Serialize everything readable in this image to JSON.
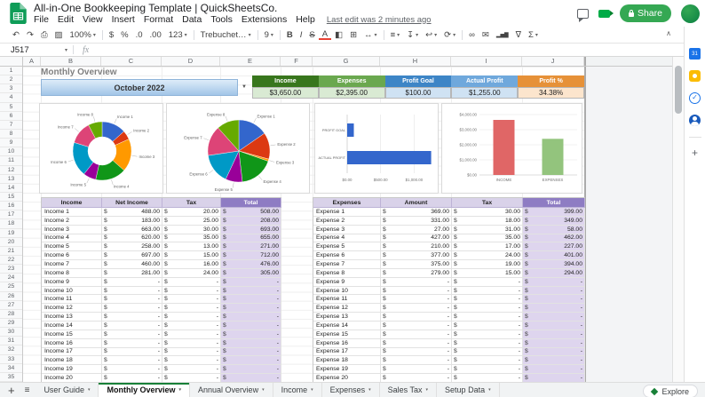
{
  "chrome": {
    "doc_title": "All-in-One Bookkeeping Template | QuickSheetsCo.",
    "menus": [
      "File",
      "Edit",
      "View",
      "Insert",
      "Format",
      "Data",
      "Tools",
      "Extensions",
      "Help"
    ],
    "last_edit": "Last edit was 2 minutes ago",
    "share_label": "Share",
    "formula": {
      "name_box": "J517",
      "fx": "fx"
    },
    "toolbar": {
      "items": [
        {
          "n": "undo-icon",
          "g": "↶"
        },
        {
          "n": "redo-icon",
          "g": "↷"
        },
        {
          "n": "print-icon",
          "g": "⎙"
        },
        {
          "n": "paint-format-icon",
          "g": "▨"
        },
        {
          "n": "zoom-select",
          "g": "100%",
          "dd": true
        },
        {
          "n": "divider"
        },
        {
          "n": "format-currency-icon",
          "g": "$"
        },
        {
          "n": "format-percent-icon",
          "g": "%"
        },
        {
          "n": "decrease-decimals-icon",
          "g": ".0"
        },
        {
          "n": "increase-decimals-icon",
          "g": ".00"
        },
        {
          "n": "number-format-select",
          "g": "123",
          "dd": true
        },
        {
          "n": "divider"
        },
        {
          "n": "font-select",
          "g": "Trebuchet…",
          "dd": true
        },
        {
          "n": "divider"
        },
        {
          "n": "font-size-select",
          "g": "9",
          "dd": true
        },
        {
          "n": "divider"
        },
        {
          "n": "bold-icon",
          "g": "B"
        },
        {
          "n": "italic-icon",
          "g": "I"
        },
        {
          "n": "strikethrough-icon",
          "g": "S"
        },
        {
          "n": "text-color-icon",
          "g": "A"
        },
        {
          "n": "fill-color-icon",
          "g": "◧"
        },
        {
          "n": "borders-icon",
          "g": "⊞"
        },
        {
          "n": "merge-cells-icon",
          "g": "↔",
          "dd": true
        },
        {
          "n": "divider"
        },
        {
          "n": "horizontal-align-icon",
          "g": "≡",
          "dd": true
        },
        {
          "n": "vertical-align-icon",
          "g": "↧",
          "dd": true
        },
        {
          "n": "text-wrap-icon",
          "g": "↩",
          "dd": true
        },
        {
          "n": "text-rotate-icon",
          "g": "⟳",
          "dd": true
        },
        {
          "n": "divider"
        },
        {
          "n": "insert-link-icon",
          "g": "∞"
        },
        {
          "n": "insert-comment-icon",
          "g": "✉"
        },
        {
          "n": "insert-chart-icon",
          "g": "▂▅▇"
        },
        {
          "n": "create-filter-icon",
          "g": "∇"
        },
        {
          "n": "functions-icon",
          "g": "Σ",
          "dd": true
        }
      ]
    }
  },
  "sheet": {
    "columns": [
      "A",
      "B",
      "C",
      "D",
      "E",
      "F",
      "G",
      "H",
      "I",
      "J"
    ],
    "row_count": 35,
    "title": "Monthly Overview",
    "month": "October 2022",
    "cards": [
      {
        "label": "Income",
        "value": "$3,650.00",
        "header_bg": "#38761d",
        "value_bg": "#d9ead3"
      },
      {
        "label": "Expenses",
        "value": "$2,395.00",
        "header_bg": "#6aa84f",
        "value_bg": "#d9ead3"
      },
      {
        "label": "Profit Goal",
        "value": "$100.00",
        "header_bg": "#3d85c6",
        "value_bg": "#cfe2f3"
      },
      {
        "label": "Actual Profit",
        "value": "$1,255.00",
        "header_bg": "#6fa8dc",
        "value_bg": "#cfe2f3"
      },
      {
        "label": "Profit %",
        "value": "34.38%",
        "header_bg": "#e69138",
        "value_bg": "#fce5cd"
      }
    ],
    "colors": {
      "table_header_bg": "#d9d2e9",
      "total_header_bg": "#8e7cc3",
      "total_header_text": "#ffffff",
      "total_cell_bg": "#ded5ee"
    }
  },
  "income_table": {
    "headers": [
      "Income",
      "Net Income",
      "Tax",
      "Total"
    ],
    "rows": [
      [
        "Income 1",
        "488.00",
        "20.00",
        "508.00"
      ],
      [
        "Income 2",
        "183.00",
        "25.00",
        "208.00"
      ],
      [
        "Income 3",
        "663.00",
        "30.00",
        "693.00"
      ],
      [
        "Income 4",
        "620.00",
        "35.00",
        "655.00"
      ],
      [
        "Income 5",
        "258.00",
        "13.00",
        "271.00"
      ],
      [
        "Income 6",
        "697.00",
        "15.00",
        "712.00"
      ],
      [
        "Income 7",
        "460.00",
        "16.00",
        "476.00"
      ],
      [
        "Income 8",
        "281.00",
        "24.00",
        "305.00"
      ],
      [
        "Income 9",
        "-",
        "-",
        "-"
      ],
      [
        "Income 10",
        "-",
        "-",
        "-"
      ],
      [
        "Income 11",
        "-",
        "-",
        "-"
      ],
      [
        "Income 12",
        "-",
        "-",
        "-"
      ],
      [
        "Income 13",
        "-",
        "-",
        "-"
      ],
      [
        "Income 14",
        "-",
        "-",
        "-"
      ],
      [
        "Income 15",
        "-",
        "-",
        "-"
      ],
      [
        "Income 16",
        "-",
        "-",
        "-"
      ],
      [
        "Income 17",
        "-",
        "-",
        "-"
      ],
      [
        "Income 18",
        "-",
        "-",
        "-"
      ],
      [
        "Income 19",
        "-",
        "-",
        "-"
      ],
      [
        "Income 20",
        "-",
        "-",
        "-"
      ]
    ]
  },
  "expense_table": {
    "headers": [
      "Expenses",
      "Amount",
      "Tax",
      "Total"
    ],
    "rows": [
      [
        "Expense 1",
        "369.00",
        "30.00",
        "399.00"
      ],
      [
        "Expense 2",
        "331.00",
        "18.00",
        "349.00"
      ],
      [
        "Expense 3",
        "27.00",
        "31.00",
        "58.00"
      ],
      [
        "Expense 4",
        "427.00",
        "35.00",
        "462.00"
      ],
      [
        "Expense 5",
        "210.00",
        "17.00",
        "227.00"
      ],
      [
        "Expense 6",
        "377.00",
        "24.00",
        "401.00"
      ],
      [
        "Expense 7",
        "375.00",
        "19.00",
        "394.00"
      ],
      [
        "Expense 8",
        "279.00",
        "15.00",
        "294.00"
      ],
      [
        "Expense 9",
        "-",
        "-",
        "-"
      ],
      [
        "Expense 10",
        "-",
        "-",
        "-"
      ],
      [
        "Expense 11",
        "-",
        "-",
        "-"
      ],
      [
        "Expense 12",
        "-",
        "-",
        "-"
      ],
      [
        "Expense 13",
        "-",
        "-",
        "-"
      ],
      [
        "Expense 14",
        "-",
        "-",
        "-"
      ],
      [
        "Expense 15",
        "-",
        "-",
        "-"
      ],
      [
        "Expense 16",
        "-",
        "-",
        "-"
      ],
      [
        "Expense 17",
        "-",
        "-",
        "-"
      ],
      [
        "Expense 18",
        "-",
        "-",
        "-"
      ],
      [
        "Expense 19",
        "-",
        "-",
        "-"
      ],
      [
        "Expense 20",
        "-",
        "-",
        "-"
      ]
    ]
  },
  "tabs": {
    "items": [
      {
        "label": "User Guide",
        "active": false
      },
      {
        "label": "Monthly Overview",
        "active": true
      },
      {
        "label": "Annual Overview",
        "active": false
      },
      {
        "label": "Income",
        "active": false
      },
      {
        "label": "Expenses",
        "active": false
      },
      {
        "label": "Sales Tax",
        "active": false
      },
      {
        "label": "Setup Data",
        "active": false
      }
    ],
    "explore": "Explore"
  },
  "chart_data": [
    {
      "type": "pie",
      "name": "income-donut",
      "labels": [
        "Income 1",
        "Income 2",
        "Income 3",
        "Income 4",
        "Income 5",
        "Income 6",
        "Income 7",
        "Income 8"
      ],
      "values": [
        488,
        183,
        663,
        620,
        258,
        697,
        460,
        281
      ],
      "hole": 0.48,
      "colors": [
        "#3366cc",
        "#dc3912",
        "#ff9900",
        "#109618",
        "#990099",
        "#0099c6",
        "#dd4477",
        "#66aa00"
      ]
    },
    {
      "type": "pie",
      "name": "expense-pie",
      "labels": [
        "Expense 1",
        "Expense 2",
        "Expense 3",
        "Expense 4",
        "Expense 5",
        "Expense 6",
        "Expense 7",
        "Expense 8"
      ],
      "values": [
        369,
        331,
        27,
        427,
        210,
        377,
        375,
        279
      ],
      "hole": 0,
      "colors": [
        "#3366cc",
        "#dc3912",
        "#ff9900",
        "#109618",
        "#990099",
        "#0099c6",
        "#dd4477",
        "#66aa00"
      ]
    },
    {
      "type": "bar",
      "name": "profit-vs-goal",
      "orientation": "horizontal",
      "categories": [
        "PROFIT GOAL",
        "ACTUAL PROFIT"
      ],
      "values": [
        100,
        1255
      ],
      "color": "#3366cc",
      "xlim": [
        0,
        1300
      ],
      "xticks": [
        0,
        500,
        1000
      ],
      "xtick_labels": [
        "$0.00",
        "$500.00",
        "$1,000.00"
      ]
    },
    {
      "type": "bar",
      "name": "income-vs-expenses",
      "categories": [
        "INCOME",
        "EXPENSES"
      ],
      "values": [
        3650,
        2395
      ],
      "colors": [
        "#e06666",
        "#93c47d"
      ],
      "ylim": [
        0,
        4000
      ],
      "yticks": [
        0,
        1000,
        2000,
        3000,
        4000
      ],
      "ytick_labels": [
        "$0.00",
        "$1,000.00",
        "$2,000.00",
        "$3,000.00",
        "$4,000.00"
      ]
    }
  ]
}
